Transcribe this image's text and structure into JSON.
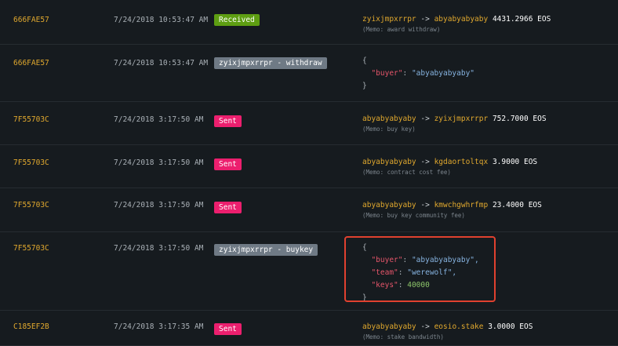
{
  "rows": [
    {
      "tx_id": "666FAE57",
      "time": "7/24/2018 10:53:47 AM",
      "badge": "Received",
      "from": "zyixjmpxrrpr",
      "arrow": "->",
      "to": "abyabyabyaby",
      "amount": "4431.2966 EOS",
      "memo": "(Memo: award withdraw)"
    },
    {
      "tx_id": "666FAE57",
      "time": "7/24/2018 10:53:47 AM",
      "badge": "zyixjmpxrrpr - withdraw",
      "json": {
        "open": "{",
        "key1": "\"buyer\"",
        "colon": ": ",
        "val1": "\"abyabyabyaby\"",
        "close": "}"
      }
    },
    {
      "tx_id": "7F55703C",
      "time": "7/24/2018 3:17:50 AM",
      "badge": "Sent",
      "from": "abyabyabyaby",
      "arrow": "->",
      "to": "zyixjmpxrrpr",
      "amount": "752.7000 EOS",
      "memo": "(Memo: buy key)"
    },
    {
      "tx_id": "7F55703C",
      "time": "7/24/2018 3:17:50 AM",
      "badge": "Sent",
      "from": "abyabyabyaby",
      "arrow": "->",
      "to": "kgdaortoltqx",
      "amount": "3.9000 EOS",
      "memo": "(Memo: contract cost fee)"
    },
    {
      "tx_id": "7F55703C",
      "time": "7/24/2018 3:17:50 AM",
      "badge": "Sent",
      "from": "abyabyabyaby",
      "arrow": "->",
      "to": "kmwchgwhrfmp",
      "amount": "23.4000 EOS",
      "memo": "(Memo: buy key community fee)"
    },
    {
      "tx_id": "7F55703C",
      "time": "7/24/2018 3:17:50 AM",
      "badge": "zyixjmpxrrpr - buykey",
      "json": {
        "open": "{",
        "key1": "\"buyer\"",
        "val1": "\"abyabyabyaby\",",
        "key2": "\"team\"",
        "val2": "\"werewolf\",",
        "key3": "\"keys\"",
        "val3": "40000",
        "colon": ": ",
        "close": "}"
      }
    },
    {
      "tx_id": "C185EF2B",
      "time": "7/24/2018 3:17:35 AM",
      "badge": "Sent",
      "from": "abyabyabyaby",
      "arrow": "->",
      "to": "eosio.stake",
      "amount": "3.0000 EOS",
      "memo": "(Memo: stake bandwidth)"
    }
  ],
  "colors": {
    "received": "#5e9e12",
    "sent": "#ec1f6e",
    "action": "#6f7a85",
    "account": "#e0a82e",
    "highlight": "#e0412f"
  }
}
